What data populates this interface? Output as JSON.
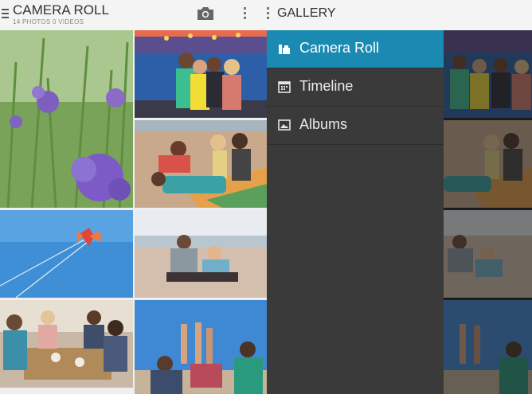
{
  "left_pane": {
    "title": "CAMERA ROLL",
    "subtitle": "14 PHOTOS 0 VIDEOS",
    "icons": [
      "menu-icon",
      "camera-icon",
      "overflow-menu-icon"
    ]
  },
  "drawer": {
    "title": "GALLERY",
    "items": [
      {
        "label": "Camera Roll",
        "icon": "camera-roll-icon",
        "selected": true
      },
      {
        "label": "Timeline",
        "icon": "calendar-icon",
        "selected": false
      },
      {
        "label": "Albums",
        "icon": "image-icon",
        "selected": false
      }
    ]
  },
  "photos": [
    {
      "subject": "lavender flowers"
    },
    {
      "subject": "four friends at carnival"
    },
    {
      "subject": "friends on beach blanket"
    },
    {
      "subject": "butterfly kite in sky"
    },
    {
      "subject": "couple on beach"
    },
    {
      "subject": "friends at restaurant table"
    },
    {
      "subject": "friends with legs up"
    }
  ],
  "colors": {
    "accent": "#1a8ab3",
    "drawer_bg": "#3a3a3a"
  }
}
